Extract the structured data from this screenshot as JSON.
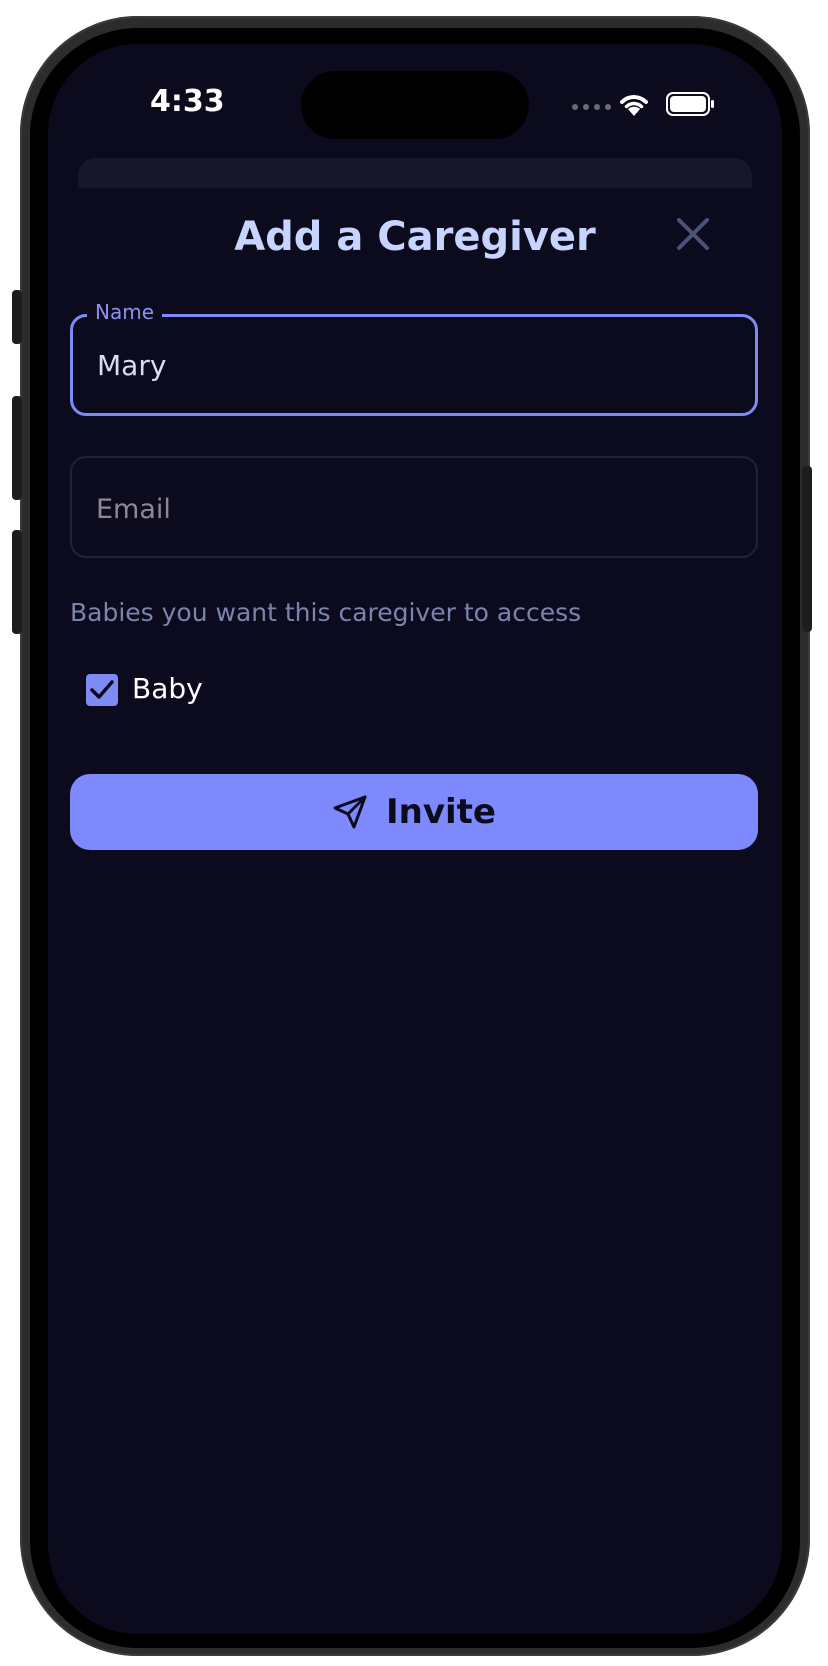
{
  "status_bar": {
    "time": "4:33"
  },
  "sheet": {
    "title": "Add a Caregiver"
  },
  "form": {
    "name_field": {
      "label": "Name",
      "value": "Mary"
    },
    "email_field": {
      "placeholder": "Email",
      "value": ""
    },
    "access_label": "Babies you want this caregiver to access",
    "babies": [
      {
        "label": "Baby",
        "checked": true
      }
    ]
  },
  "actions": {
    "invite_label": "Invite"
  },
  "icons": {
    "close": "close-icon",
    "send": "send-icon",
    "wifi": "wifi-icon",
    "battery": "battery-icon",
    "check": "checkmark-icon"
  },
  "colors": {
    "background": "#0c0b1e",
    "accent": "#7d89fc",
    "title": "#c6d4ff"
  }
}
